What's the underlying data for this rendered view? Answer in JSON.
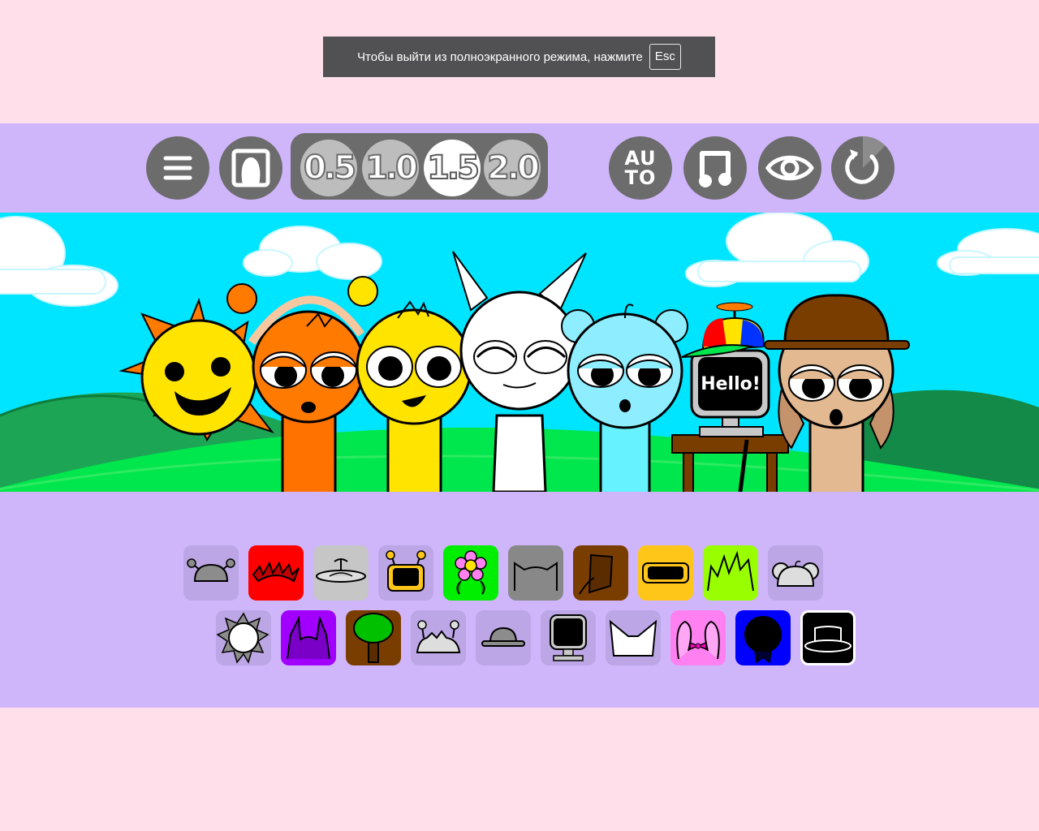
{
  "fullscreen_notice": {
    "text": "Чтобы выйти из полноэкранного режима, нажмите",
    "key": "Esc"
  },
  "toolbar": {
    "menu_icon": "hamburger-menu-icon",
    "character_icon": "character-frame-icon",
    "speeds": [
      "0.5",
      "1.0",
      "1.5",
      "2.0"
    ],
    "active_speed": "1.5",
    "auto_label_top": "AU",
    "auto_label_bottom": "TO",
    "music_icon": "music-note-icon",
    "view_icon": "eye-icon",
    "reset_icon": "reset-icon"
  },
  "stage": {
    "sky_color": "#00e5ff",
    "screen_text": "Hello!",
    "characters": [
      "sun",
      "orange-headphones",
      "yellow",
      "white-cat",
      "light-blue-mouse",
      "computer",
      "brown-hat"
    ]
  },
  "palette": {
    "row1": [
      {
        "name": "grey-antenna-hat",
        "bg": "#bca6e6"
      },
      {
        "name": "red-spiky",
        "bg": "#ff0000"
      },
      {
        "name": "grey-propeller",
        "bg": "#c6c6c6"
      },
      {
        "name": "orange-antenna-tv",
        "bg": "#bca6e6"
      },
      {
        "name": "green-flower",
        "bg": "#00ee00"
      },
      {
        "name": "grey-cat-ears",
        "bg": "#888888"
      },
      {
        "name": "brown-bucket",
        "bg": "#7a3d00"
      },
      {
        "name": "yellow-goggles",
        "bg": "#ffc61a"
      },
      {
        "name": "lime-spiky-hair",
        "bg": "#99ff00"
      },
      {
        "name": "grey-mouse-ears",
        "bg": "#bca6e6"
      }
    ],
    "row2": [
      {
        "name": "grey-sun",
        "bg": "#bca6e6"
      },
      {
        "name": "purple-horns",
        "bg": "#a100ff"
      },
      {
        "name": "brown-tree",
        "bg": "#7a3d00"
      },
      {
        "name": "grey-antenna-hair",
        "bg": "#bca6e6"
      },
      {
        "name": "grey-bowler-hat",
        "bg": "#bca6e6"
      },
      {
        "name": "grey-computer",
        "bg": "#bca6e6"
      },
      {
        "name": "white-envelope-hat",
        "bg": "#bca6e6"
      },
      {
        "name": "pink-bow-ears",
        "bg": "#ff80f0"
      },
      {
        "name": "blue-dark-circle",
        "bg": "#0000ff"
      },
      {
        "name": "black-tophat",
        "bg": "#000000"
      }
    ]
  }
}
